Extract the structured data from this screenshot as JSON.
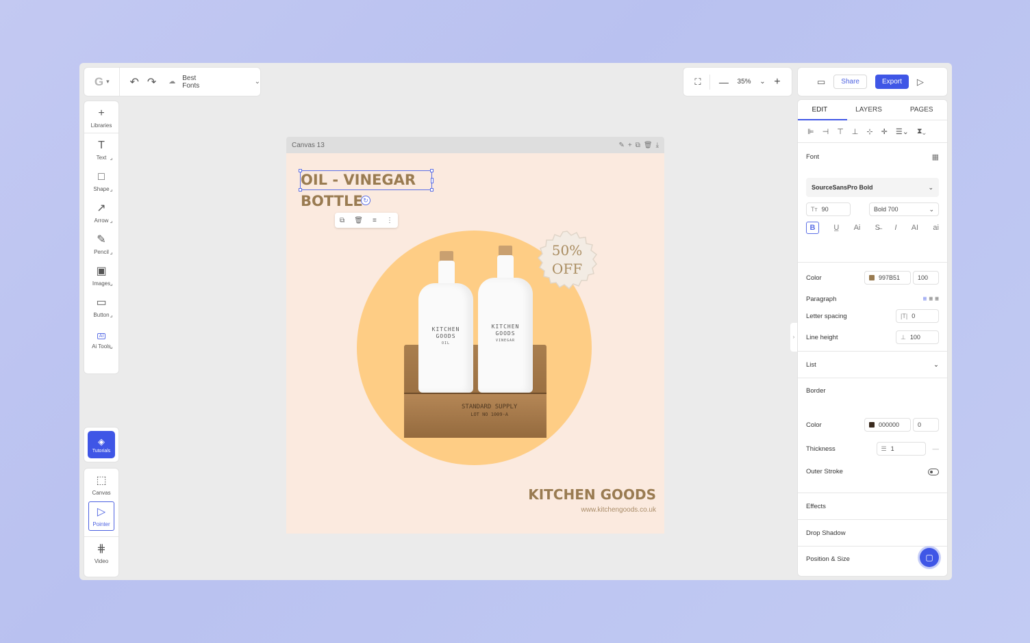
{
  "toolbar": {
    "file_name": "Best Fonts",
    "zoom": "35%",
    "share_label": "Share",
    "export_label": "Export"
  },
  "left_tools": [
    {
      "label": "Libraries",
      "icon": "plus-icon"
    },
    {
      "label": "Text",
      "icon": "text-icon"
    },
    {
      "label": "Shape",
      "icon": "square-icon"
    },
    {
      "label": "Arrow",
      "icon": "arrow-icon"
    },
    {
      "label": "Pencil",
      "icon": "pencil-icon"
    },
    {
      "label": "Images",
      "icon": "image-icon"
    },
    {
      "label": "Button",
      "icon": "button-icon"
    },
    {
      "label": "Ai Tools",
      "icon": "ai-icon"
    }
  ],
  "tutorials_label": "Tutorials",
  "bottom_tools": [
    {
      "label": "Canvas",
      "icon": "canvas-icon"
    },
    {
      "label": "Pointer",
      "icon": "pointer-icon"
    },
    {
      "label": "Video",
      "icon": "video-icon"
    }
  ],
  "canvas": {
    "name": "Canvas 13",
    "headline_line1": "OIL - VINEGAR",
    "headline_line2": "BOTTLE",
    "badge_line1": "50%",
    "badge_line2": "OFF",
    "bottle1_label": "KITCHEN\nGOODS",
    "bottle1_sub": "OIL",
    "bottle2_label": "KITCHEN\nGOODS",
    "bottle2_sub": "VINEGAR",
    "crate_line1": "STANDARD SUPPLY",
    "crate_line2": "LOT NO 1009-A",
    "brand": "KITCHEN GOODS",
    "brand_url": "www.kitchengoods.co.uk",
    "background_color": "#fbeadf",
    "circle_color": "#fecd85"
  },
  "panel": {
    "tabs": [
      "EDIT",
      "LAYERS",
      "PAGES"
    ],
    "font_title": "Font",
    "font_family": "SourceSansPro Bold",
    "font_size": "90",
    "font_weight": "Bold 700",
    "color_label": "Color",
    "color_hex": "997B51",
    "color_opacity": "100",
    "paragraph_label": "Paragraph",
    "letter_spacing_label": "Letter spacing",
    "letter_spacing": "0",
    "line_height_label": "Line height",
    "line_height": "100",
    "list_label": "List",
    "border_label": "Border",
    "border_color_label": "Color",
    "border_color_hex": "000000",
    "border_color_opacity": "0",
    "thickness_label": "Thickness",
    "thickness": "1",
    "outer_stroke_label": "Outer Stroke",
    "effects_label": "Effects",
    "drop_shadow_label": "Drop Shadow",
    "position_size_label": "Position & Size"
  },
  "colors": {
    "accent": "#3f56e6",
    "text_brown": "#997b51"
  }
}
